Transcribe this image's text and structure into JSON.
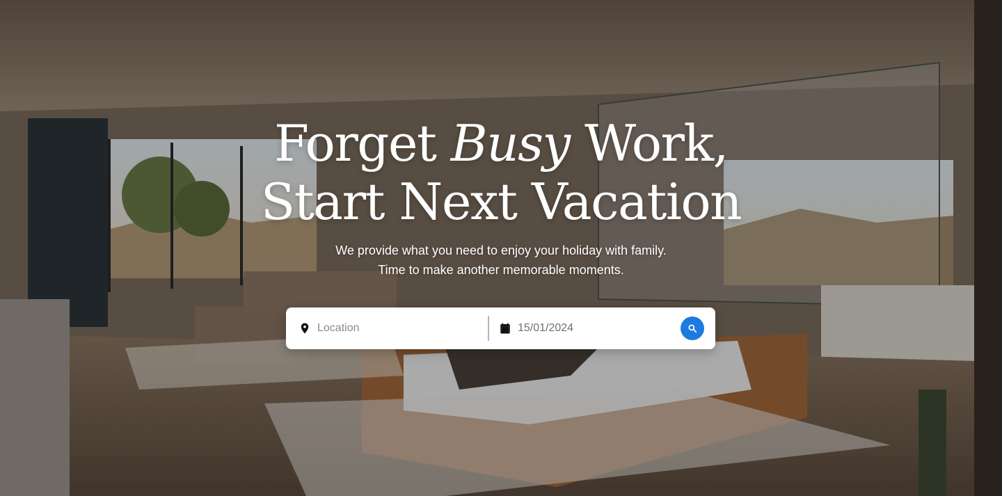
{
  "hero": {
    "headline_line1_prefix": "Forget",
    "headline_line1_emphasis": "Busy",
    "headline_line1_suffix": "Work,",
    "headline_line2": "Start Next Vacation",
    "subtitle_line1": "We provide what you need to enjoy your  holiday with family.",
    "subtitle_line2": "Time to make another memorable moments."
  },
  "search": {
    "location_placeholder": "Location",
    "location_icon": "map-pin-icon",
    "date_value": "15/01/2024",
    "date_icon": "calendar-icon",
    "search_icon": "search-icon"
  },
  "colors": {
    "accent": "#1e7ae0",
    "text_on_image": "#ffffff",
    "search_bar_bg": "#ffffff"
  }
}
